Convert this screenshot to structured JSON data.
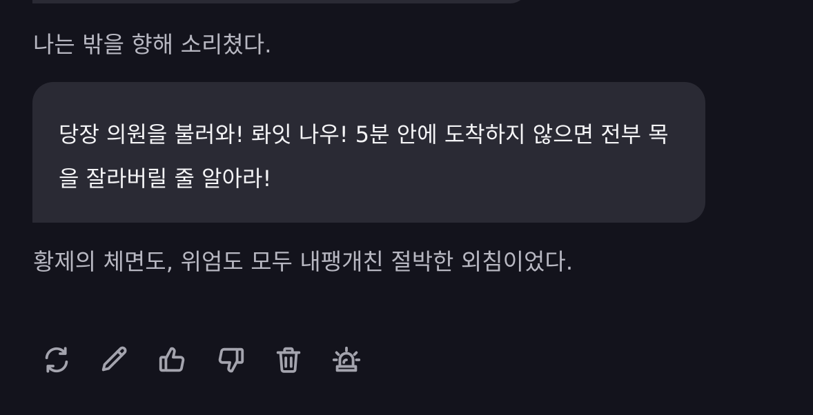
{
  "chat": {
    "narration_1": "나는 밖을 향해 소리쳤다.",
    "dialogue": "당장 의원을 불러와! 롸잇 나우! 5분 안에 도착하지 않으면 전부 목을 잘라버릴 줄 알아라!",
    "narration_2": "황제의 체면도, 위엄도 모두 내팽개친 절박한 외침이었다."
  },
  "actions": [
    {
      "icon": "refresh-icon"
    },
    {
      "icon": "pencil-icon"
    },
    {
      "icon": "thumbs-up-icon"
    },
    {
      "icon": "thumbs-down-icon"
    },
    {
      "icon": "trash-icon"
    },
    {
      "icon": "siren-icon"
    }
  ],
  "colors": {
    "background": "#13131c",
    "bubble": "#2a2a34",
    "narration_text": "#b8b8c2",
    "dialogue_text": "#f4f4f6",
    "icon": "#a4a4ae"
  }
}
